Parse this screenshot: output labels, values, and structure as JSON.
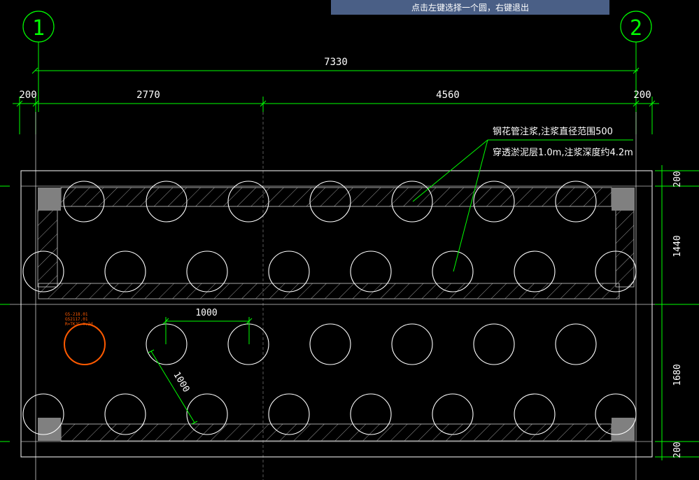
{
  "prompt_bar": {
    "text": "点击左键选择一个圆，右键退出"
  },
  "axes": {
    "left": "1",
    "right": "2"
  },
  "dimensions": {
    "overall": "7330",
    "segment_left_edge": "200",
    "segment_a": "2770",
    "segment_b": "4560",
    "segment_right_edge": "200",
    "right_top": "200",
    "right_middle": "1440",
    "right_lower": "1680",
    "right_bottom": "200",
    "pile_spacing_horizontal": "1000",
    "pile_spacing_diagonal": "1000"
  },
  "annotation": {
    "line1": "钢花管注浆,注浆直径范围500",
    "line2": "穿透淤泥层1.0m,注浆深度约4.2m"
  },
  "selected_circle_label": {
    "line1": "GS-218.01",
    "line2": "GS2117.01",
    "line3": "R=TKJC Y.2d"
  },
  "colors": {
    "background": "#000000",
    "dimension": "#00ff00",
    "outline": "#ffffff",
    "hatch": "#aaaaaa",
    "selected": "#ff5a00",
    "corner_block": "#808080",
    "prompt_bg": "#4a5f86"
  }
}
